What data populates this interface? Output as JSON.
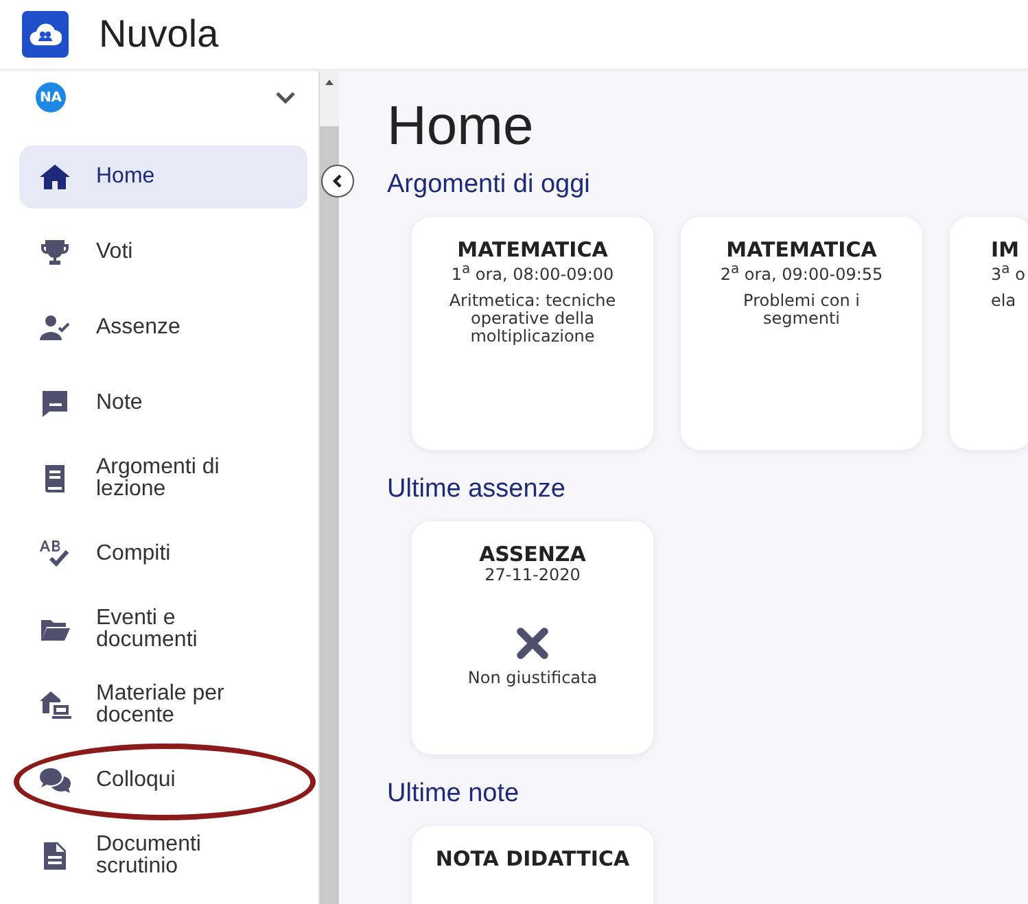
{
  "app": {
    "title": "Nuvola"
  },
  "user": {
    "initials": "NA"
  },
  "sidebar": {
    "items": [
      {
        "label": "Home",
        "selected": true,
        "highlighted": false
      },
      {
        "label": "Voti",
        "selected": false,
        "highlighted": false
      },
      {
        "label": "Assenze",
        "selected": false,
        "highlighted": false
      },
      {
        "label": "Note",
        "selected": false,
        "highlighted": false
      },
      {
        "label": "Argomenti di lezione",
        "selected": false,
        "highlighted": false
      },
      {
        "label": "Compiti",
        "selected": false,
        "highlighted": false
      },
      {
        "label": "Eventi e documenti",
        "selected": false,
        "highlighted": false
      },
      {
        "label": "Materiale per docente",
        "selected": false,
        "highlighted": false
      },
      {
        "label": "Colloqui",
        "selected": false,
        "highlighted": true
      },
      {
        "label": "Documenti scrutinio",
        "selected": false,
        "highlighted": false
      }
    ]
  },
  "page": {
    "title": "Home"
  },
  "sections": [
    {
      "title": "Argomenti di oggi",
      "kind": "lessons",
      "cards": [
        {
          "title": "MATEMATICA",
          "subtitle": "1$^{a}$ ora, 08:00-09:00",
          "body": "Aritmetica: tecniche operative della moltiplicazione",
          "truncated": false
        },
        {
          "title": "MATEMATICA",
          "subtitle": "2$^{a}$ ora, 09:00-09:55",
          "body": "Problemi con i segmenti",
          "truncated": false
        },
        {
          "title": "IM",
          "subtitle": "3$^{a}$ o",
          "body": "ela",
          "truncated": true
        }
      ]
    },
    {
      "title": "Ultime assenze",
      "kind": "absences",
      "cards": [
        {
          "title": "ASSENZA",
          "subtitle": "27-11-2020",
          "body": "Non giustificata",
          "truncated": false
        }
      ]
    },
    {
      "title": "Ultime note",
      "kind": "notes",
      "cards": [
        {
          "title": "NOTA DIDATTICA",
          "truncated": false
        }
      ]
    }
  ]
}
